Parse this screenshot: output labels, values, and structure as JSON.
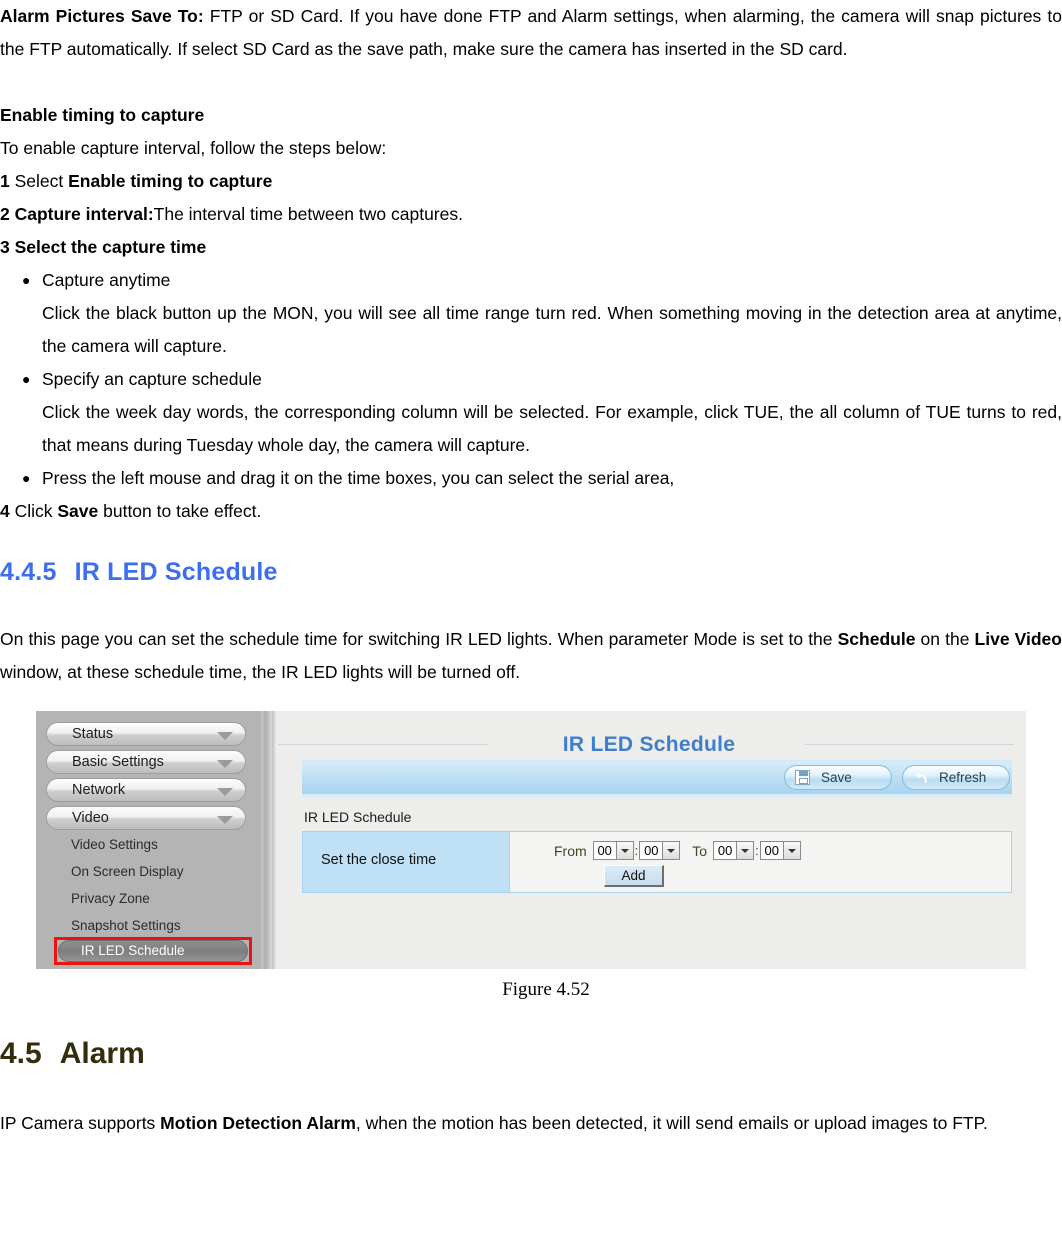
{
  "intro": {
    "label": "Alarm Pictures Save To:",
    "text": " FTP or SD Card. If you have done FTP and Alarm settings, when alarming, the camera will snap pictures to the FTP automatically. If select SD Card as the save path, make sure the camera has inserted in the SD card."
  },
  "enable_section": {
    "heading": "Enable timing to capture",
    "lead": "To enable capture interval, follow the steps below:",
    "step1_num": "1",
    "step1_pre": " Select ",
    "step1_bold": "Enable timing to capture",
    "step2_bold": "2 Capture interval:",
    "step2_text": "The interval time between two captures.",
    "step3_bold": "3 Select the capture time",
    "bullets": [
      {
        "label": "Capture anytime",
        "body": "Click the black button up the MON, you will see all time range turn red. When something moving in the detection area at anytime, the camera will capture."
      },
      {
        "label": "Specify an capture schedule",
        "body": "Click the week day words, the corresponding column will be selected. For example, click TUE, the all column of TUE turns to red, that means during Tuesday whole day, the camera will capture."
      },
      {
        "label": "Press the left mouse and drag it on the time boxes, you can select the serial area,",
        "body": ""
      }
    ],
    "step4_num": "4",
    "step4_pre": " Click ",
    "step4_bold": "Save",
    "step4_post": " button to take effect."
  },
  "section_445": {
    "number": "4.4.5",
    "title": "IR LED Schedule",
    "color": "#3d6df0",
    "paragraph_1": "On this page you can set the schedule time for switching IR LED lights. When parameter Mode is set to the ",
    "paragraph_bold_1": "Schedule",
    "paragraph_2": " on the ",
    "paragraph_bold_2": "Live Video",
    "paragraph_3": " window, at these schedule time, the IR LED lights will be turned off."
  },
  "screenshot": {
    "sidebar": {
      "nav_buttons": [
        {
          "label": "Status",
          "icon": "chevron-down-icon"
        },
        {
          "label": "Basic Settings",
          "icon": "chevron-down-icon"
        },
        {
          "label": "Network",
          "icon": "chevron-down-icon"
        },
        {
          "label": "Video",
          "icon": "chevron-down-icon"
        }
      ],
      "sub_items": [
        {
          "label": "Video Settings",
          "selected": false
        },
        {
          "label": "On Screen Display",
          "selected": false
        },
        {
          "label": "Privacy Zone",
          "selected": false
        },
        {
          "label": "Snapshot Settings",
          "selected": false
        },
        {
          "label": "IR LED Schedule",
          "selected": true
        }
      ],
      "highlight_color": "#ee1111"
    },
    "main": {
      "title": "IR LED Schedule",
      "title_color": "#3e7ecb",
      "toolbar": {
        "save_label": "Save",
        "save_icon": "floppy-disk-icon",
        "refresh_label": "Refresh",
        "refresh_icon": "undo-arrow-icon"
      },
      "section_label": "IR LED Schedule",
      "row_label": "Set the close time",
      "from_word": "From",
      "to_word": "To",
      "from_hour": "00",
      "from_minute": "00",
      "to_hour": "00",
      "to_minute": "00",
      "colon": ":",
      "add_label": "Add"
    }
  },
  "figure_caption": "Figure 4.52",
  "section_45": {
    "number": "4.5",
    "title": "Alarm",
    "color": "#332d0b",
    "paragraph_1": "IP Camera supports ",
    "paragraph_bold": "Motion Detection Alarm",
    "paragraph_2": ", when the motion has been detected, it will send emails or upload images to FTP."
  }
}
